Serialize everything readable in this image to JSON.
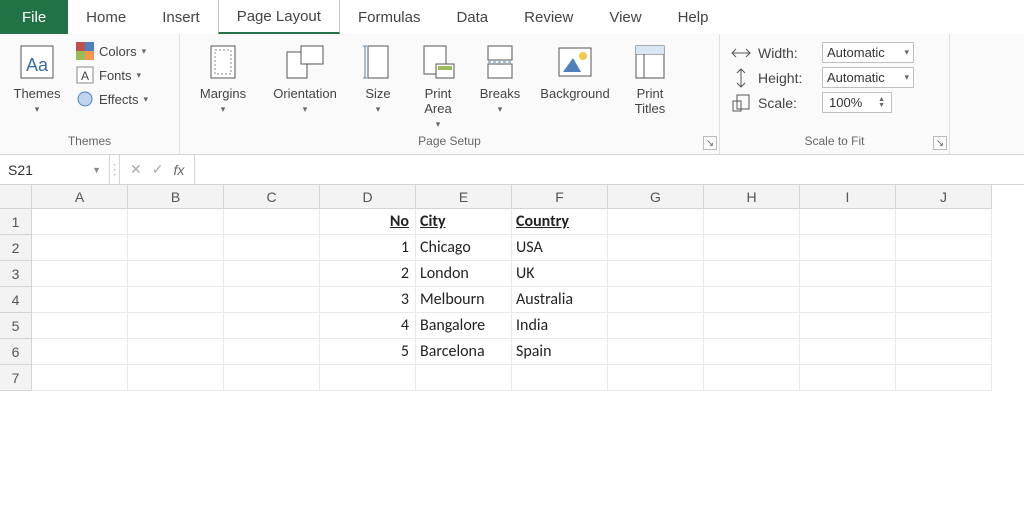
{
  "tabs": {
    "file": "File",
    "home": "Home",
    "insert": "Insert",
    "page_layout": "Page Layout",
    "formulas": "Formulas",
    "data": "Data",
    "review": "Review",
    "view": "View",
    "help": "Help"
  },
  "ribbon": {
    "themes": {
      "title": "Themes",
      "button": "Themes",
      "colors": "Colors",
      "fonts": "Fonts",
      "effects": "Effects"
    },
    "page_setup": {
      "title": "Page Setup",
      "margins": "Margins",
      "orientation": "Orientation",
      "size": "Size",
      "print_area": "Print\nArea",
      "breaks": "Breaks",
      "background": "Background",
      "print_titles": "Print\nTitles"
    },
    "scale": {
      "title": "Scale to Fit",
      "width_label": "Width:",
      "height_label": "Height:",
      "scale_label": "Scale:",
      "width_value": "Automatic",
      "height_value": "Automatic",
      "scale_value": "100%"
    }
  },
  "namebox": "S21",
  "fx": "fx",
  "columns": [
    "A",
    "B",
    "C",
    "D",
    "E",
    "F",
    "G",
    "H",
    "I",
    "J"
  ],
  "rows": [
    "1",
    "2",
    "3",
    "4",
    "5",
    "6",
    "7"
  ],
  "sheet": {
    "headers": {
      "no": "No",
      "city": "City",
      "country": "Country"
    },
    "data": [
      {
        "no": "1",
        "city": "Chicago",
        "country": "USA"
      },
      {
        "no": "2",
        "city": "London",
        "country": "UK"
      },
      {
        "no": "3",
        "city": "Melbourn",
        "country": "Australia"
      },
      {
        "no": "4",
        "city": "Bangalore",
        "country": "India"
      },
      {
        "no": "5",
        "city": "Barcelona",
        "country": "Spain"
      }
    ]
  }
}
